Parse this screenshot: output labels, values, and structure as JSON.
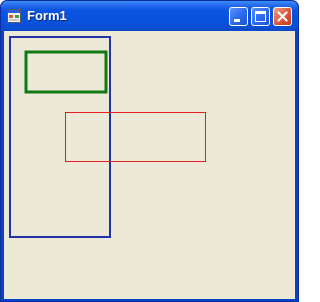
{
  "window": {
    "title": "Form1",
    "icon": "form-app-icon",
    "buttons": {
      "minimize_icon": "minimize-icon",
      "maximize_icon": "maximize-icon",
      "close_icon": "close-icon"
    }
  },
  "shapes": [
    {
      "name": "blue-rectangle",
      "color": "#2233aa"
    },
    {
      "name": "green-rectangle",
      "color": "#107a10"
    },
    {
      "name": "red-rectangle",
      "color": "#e02020"
    }
  ],
  "colors": {
    "titlebar": "#0852e0",
    "client_background": "#ece9d8"
  }
}
